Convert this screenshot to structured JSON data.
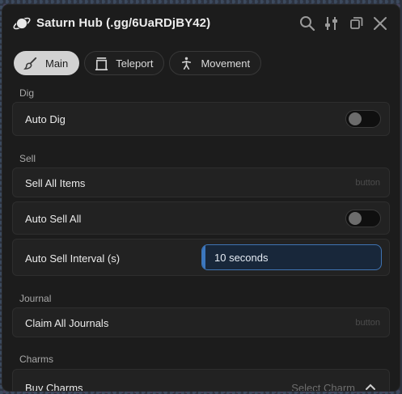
{
  "window": {
    "title": "Saturn Hub (.gg/6UaRDjBY42)",
    "icons": [
      "planet-logo",
      "search-icon",
      "settings-sliders-icon",
      "copy-window-icon",
      "close-icon"
    ]
  },
  "tabs": [
    {
      "label": "Main",
      "icon": "brush-icon",
      "active": true
    },
    {
      "label": "Teleport",
      "icon": "portal-icon",
      "active": false
    },
    {
      "label": "Movement",
      "icon": "running-person-icon",
      "active": false
    }
  ],
  "sections": {
    "dig": {
      "label": "Dig",
      "auto_dig": {
        "label": "Auto Dig",
        "enabled": false
      }
    },
    "sell": {
      "label": "Sell",
      "sell_all": {
        "label": "Sell All Items",
        "hint": "button"
      },
      "auto_sell": {
        "label": "Auto Sell All",
        "enabled": false
      },
      "interval": {
        "label": "Auto Sell Interval (s)",
        "value_text": "10 seconds",
        "fill_fraction": 0.02
      }
    },
    "journal": {
      "label": "Journal",
      "claim": {
        "label": "Claim All Journals",
        "hint": "button"
      }
    },
    "charms": {
      "label": "Charms",
      "buy": {
        "label": "Buy Charms",
        "placeholder": "Select Charm"
      }
    }
  },
  "colors": {
    "window_bg": "#1c1c1c",
    "row_bg": "#222222",
    "accent": "#3b77c0",
    "active_tab": "#d2d2d2"
  }
}
